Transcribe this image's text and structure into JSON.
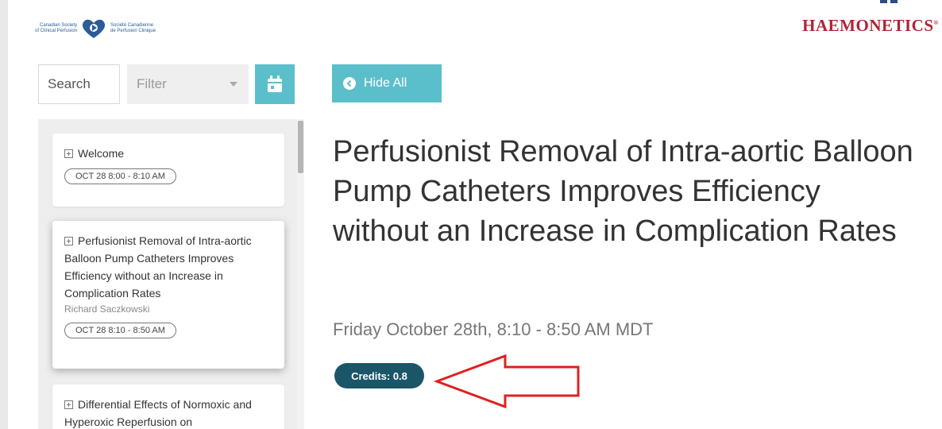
{
  "header": {
    "csp_left_line1": "Canadian Society",
    "csp_left_line2": "of Clinical Perfusion",
    "csp_right_line1": "Société Canadienne",
    "csp_right_line2": "de Perfusion Clinique",
    "sponsor": "HAEMONETICS",
    "sponsor_mark": "®"
  },
  "toolbar": {
    "search_placeholder": "Search",
    "filter_label": "Filter",
    "calendar_icon": "calendar-icon",
    "hide_all_label": "Hide All"
  },
  "sidebar": {
    "items": [
      {
        "title": "Welcome",
        "speaker": "",
        "time": "OCT 28 8:00 - 8:10 AM"
      },
      {
        "title": "Perfusionist Removal of Intra-aortic Balloon Pump Catheters Improves Efficiency without an Increase in Complication Rates",
        "speaker": "Richard Saczkowski",
        "time": "OCT 28 8:10 - 8:50 AM"
      },
      {
        "title": "Differential Effects of Normoxic and Hyperoxic Reperfusion on",
        "speaker": "",
        "time": ""
      }
    ]
  },
  "main": {
    "title": "Perfusionist Removal of Intra-aortic Balloon Pump Catheters Improves Efficiency without an Increase in Complication Rates",
    "date": "Friday October 28th, 8:10 - 8:50 AM MDT",
    "credits": "Credits: 0.8"
  },
  "colors": {
    "accent": "#5bbfcb",
    "credits_bg": "#1b5668",
    "annotation_arrow": "#e02020",
    "sponsor_red": "#b22234"
  }
}
